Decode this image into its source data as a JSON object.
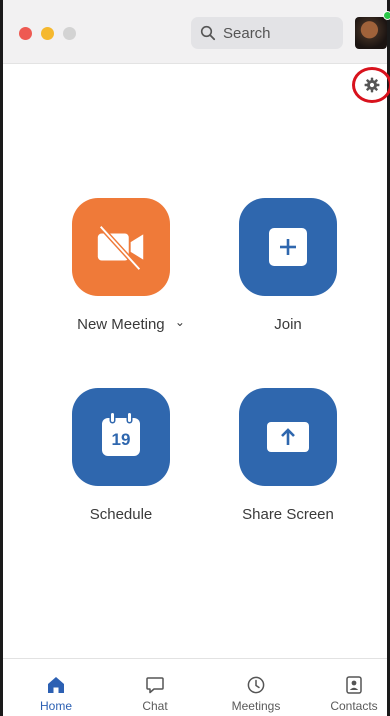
{
  "search": {
    "label": "Search"
  },
  "actions": {
    "new_meeting": {
      "label": "New Meeting",
      "dropdown_glyph": "⌄"
    },
    "join": {
      "label": "Join"
    },
    "schedule": {
      "label": "Schedule",
      "calendar_day": "19"
    },
    "share_screen": {
      "label": "Share Screen"
    }
  },
  "tabs": [
    {
      "label": "Home",
      "icon": "home-icon",
      "active": true
    },
    {
      "label": "Chat",
      "icon": "chat-icon",
      "active": false
    },
    {
      "label": "Meetings",
      "icon": "clock-icon",
      "active": false
    },
    {
      "label": "Contacts",
      "icon": "contacts-icon",
      "active": false
    }
  ],
  "colors": {
    "accent_blue": "#2f67ae",
    "accent_orange": "#ef7a39",
    "highlight_red": "#d8121d",
    "active_tab": "#2c60b3",
    "status_online": "#2bc84a"
  }
}
